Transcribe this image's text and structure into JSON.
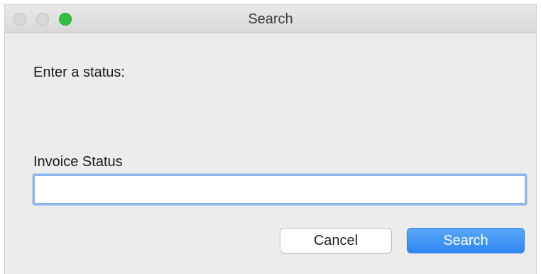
{
  "window": {
    "title": "Search",
    "traffic_lights": [
      "close-icon",
      "minimize-icon",
      "zoom-icon"
    ],
    "zoom_color": "#2fc33d"
  },
  "dialog": {
    "prompt": "Enter a status:",
    "field_label": "Invoice Status",
    "field_value": "",
    "field_placeholder": ""
  },
  "buttons": {
    "cancel_label": "Cancel",
    "search_label": "Search",
    "search_color": "#3a8ff5"
  }
}
